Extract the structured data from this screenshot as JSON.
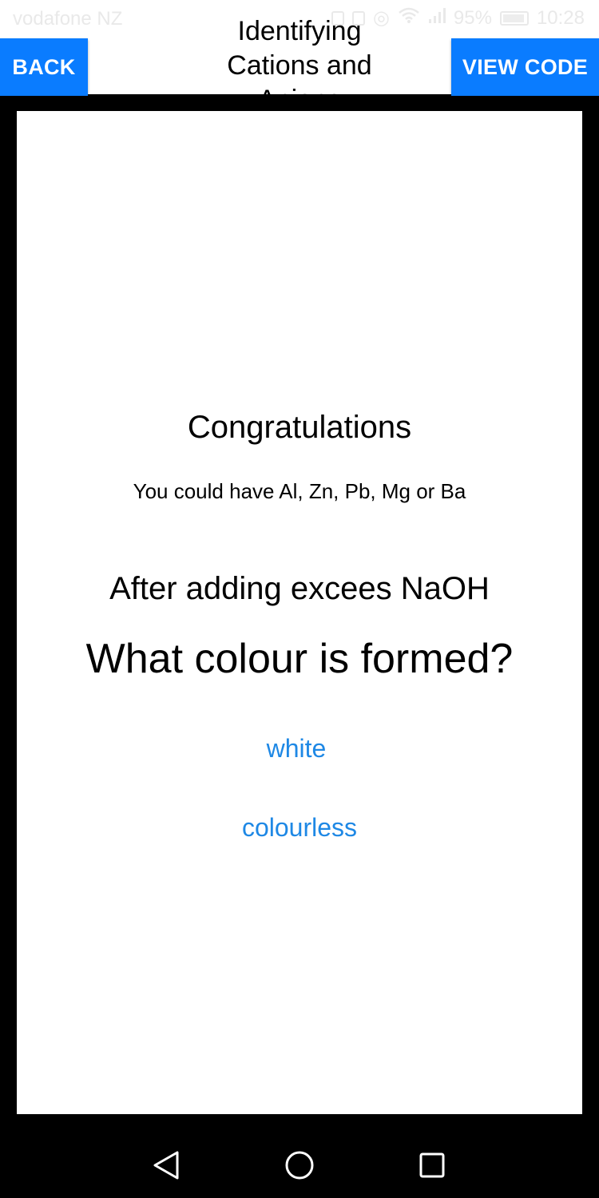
{
  "status_bar": {
    "carrier": "vodafone NZ",
    "battery": "95%",
    "time": "10:28"
  },
  "header": {
    "back_label": "BACK",
    "title": "Identifying Cations and Anions",
    "view_code_label": "VIEW CODE"
  },
  "screen": {
    "congrats": "Congratulations",
    "possible_ions": "You could have Al, Zn, Pb, Mg or Ba",
    "instruction": "After adding excees NaOH",
    "question": "What colour is formed?",
    "options": [
      {
        "label": "white"
      },
      {
        "label": "colourless"
      }
    ]
  },
  "nav": {
    "icons": [
      "back-triangle-icon",
      "home-circle-icon",
      "recents-square-icon"
    ]
  },
  "colors": {
    "accent_button": "#0a7cff",
    "option_link": "#1e88e5",
    "frame": "#000000",
    "card": "#ffffff"
  }
}
